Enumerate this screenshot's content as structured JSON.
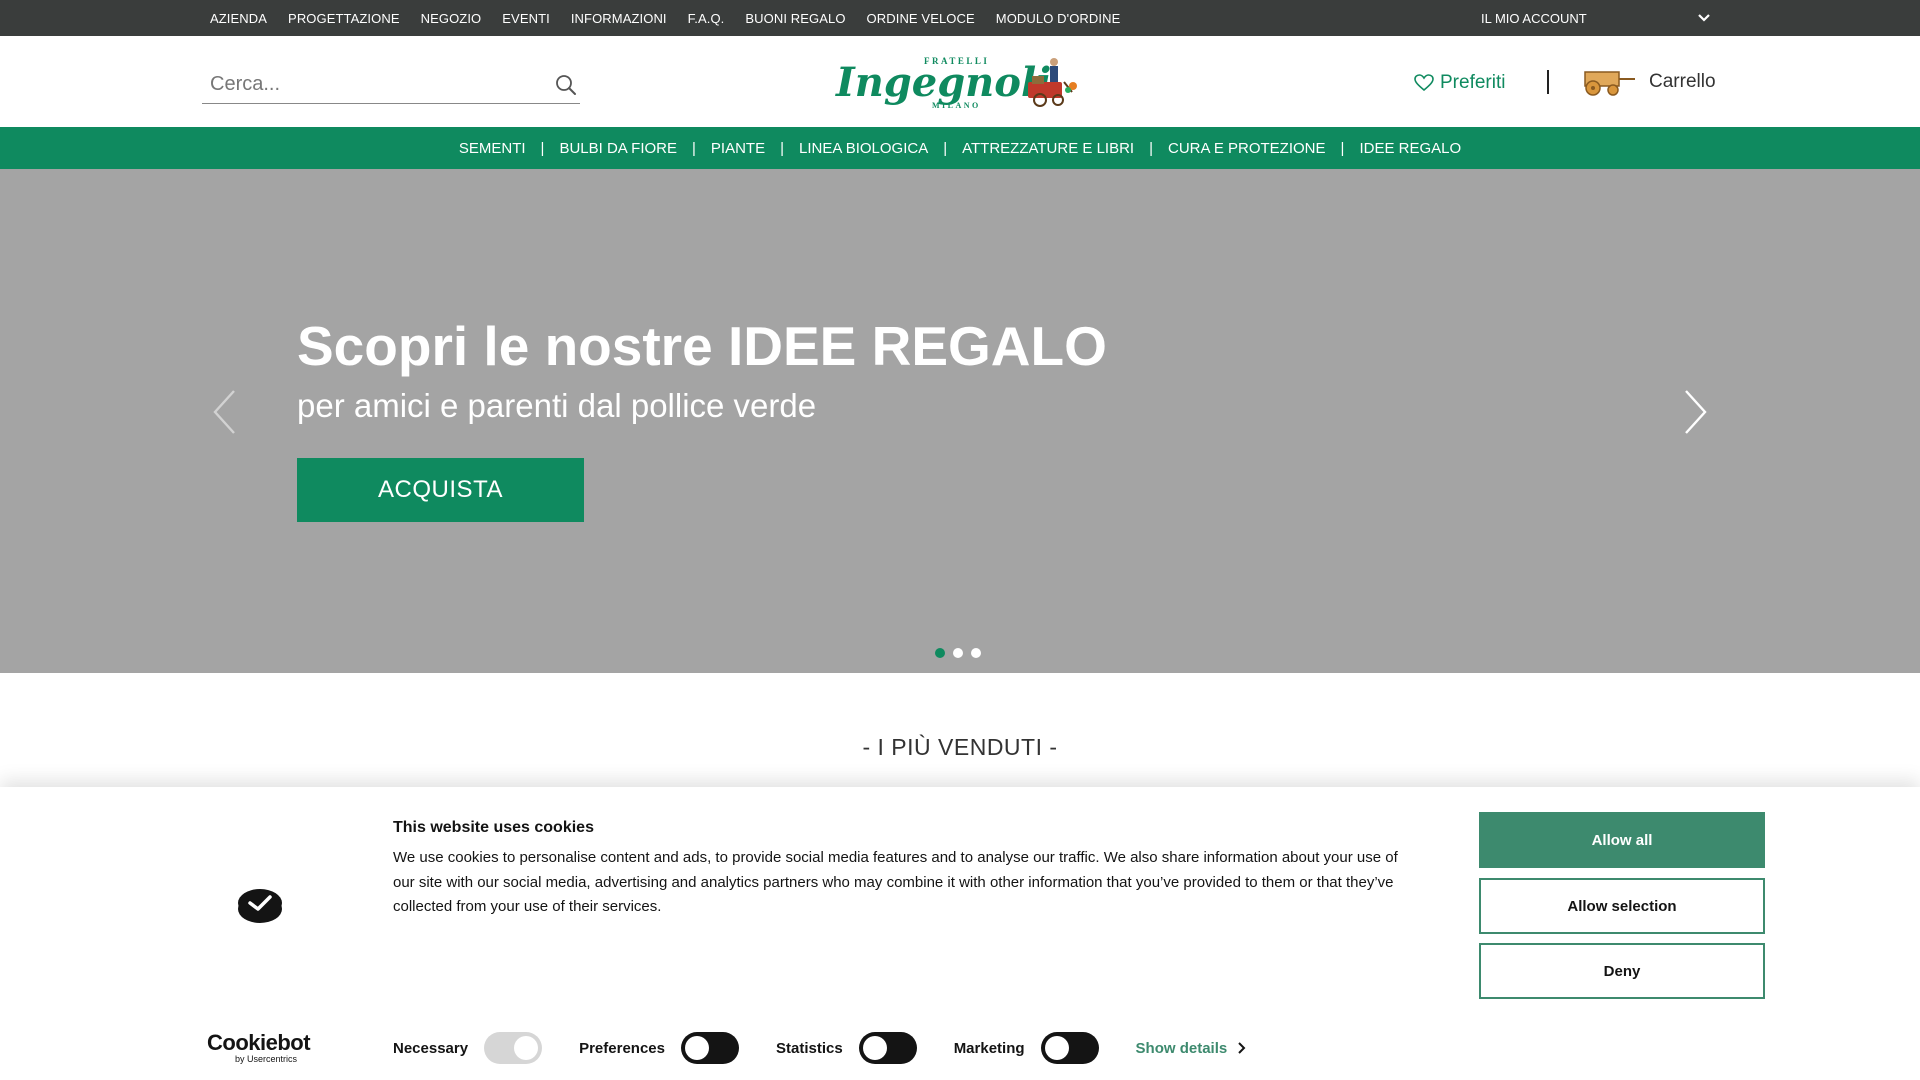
{
  "topbar": {
    "links": [
      "AZIENDA",
      "PROGETTAZIONE",
      "NEGOZIO",
      "EVENTI",
      "INFORMAZIONI",
      "F.A.Q.",
      "BUONI REGALO",
      "ORDINE VELOCE",
      "MODULO D'ORDINE"
    ],
    "account_label": "IL MIO ACCOUNT"
  },
  "header": {
    "search_placeholder": "Cerca...",
    "logo_text": "Ingegnoli",
    "logo_top": "FRATELLI",
    "logo_bottom": "MILANO",
    "favorites_label": "Preferiti",
    "cart_label": "Carrello"
  },
  "nav": {
    "items": [
      "SEMENTI",
      "BULBI DA FIORE",
      "PIANTE",
      "LINEA BIOLOGICA",
      "ATTREZZATURE E LIBRI",
      "CURA E PROTEZIONE",
      "IDEE REGALO"
    ],
    "separator": "|"
  },
  "hero": {
    "title": "Scopri le nostre IDEE REGALO",
    "subtitle": "per amici e parenti dal pollice verde",
    "cta_label": "ACQUISTA",
    "slides_count": 3,
    "active_slide": 1
  },
  "section": {
    "title": "- I PIÙ VENDUTI -"
  },
  "cookie": {
    "title": "This website uses cookies",
    "body": "We use cookies to personalise content and ads, to provide social media features and to analyse our traffic. We also share information about your use of our site with our social media, advertising and analytics partners who may combine it with other information that you’ve provided to them or that they’ve collected from your use of their services.",
    "allow_all_label": "Allow all",
    "allow_selection_label": "Allow selection",
    "deny_label": "Deny",
    "toggles": [
      {
        "label": "Necessary",
        "state": "on",
        "disabled": true
      },
      {
        "label": "Preferences",
        "state": "off",
        "disabled": false
      },
      {
        "label": "Statistics",
        "state": "off",
        "disabled": false
      },
      {
        "label": "Marketing",
        "state": "off",
        "disabled": false
      }
    ],
    "details_label": "Show details",
    "brand_name": "Cookiebot",
    "brand_sub": "by Usercentrics"
  },
  "colors": {
    "brand_green": "#0f8a5f",
    "cookie_green": "#3d8a6e",
    "topbar_bg": "#3a3d3c",
    "hero_bg": "#a4a4a4"
  },
  "icons": {
    "search": "search-icon",
    "favorites": "heart-icon",
    "cart": "cart-wagon-icon",
    "account_dropdown": "chevron-down-icon",
    "hero_prev": "chevron-left-icon",
    "hero_next": "chevron-right-icon",
    "cookie_badge": "cookie-check-icon",
    "details": "chevron-right-icon"
  }
}
